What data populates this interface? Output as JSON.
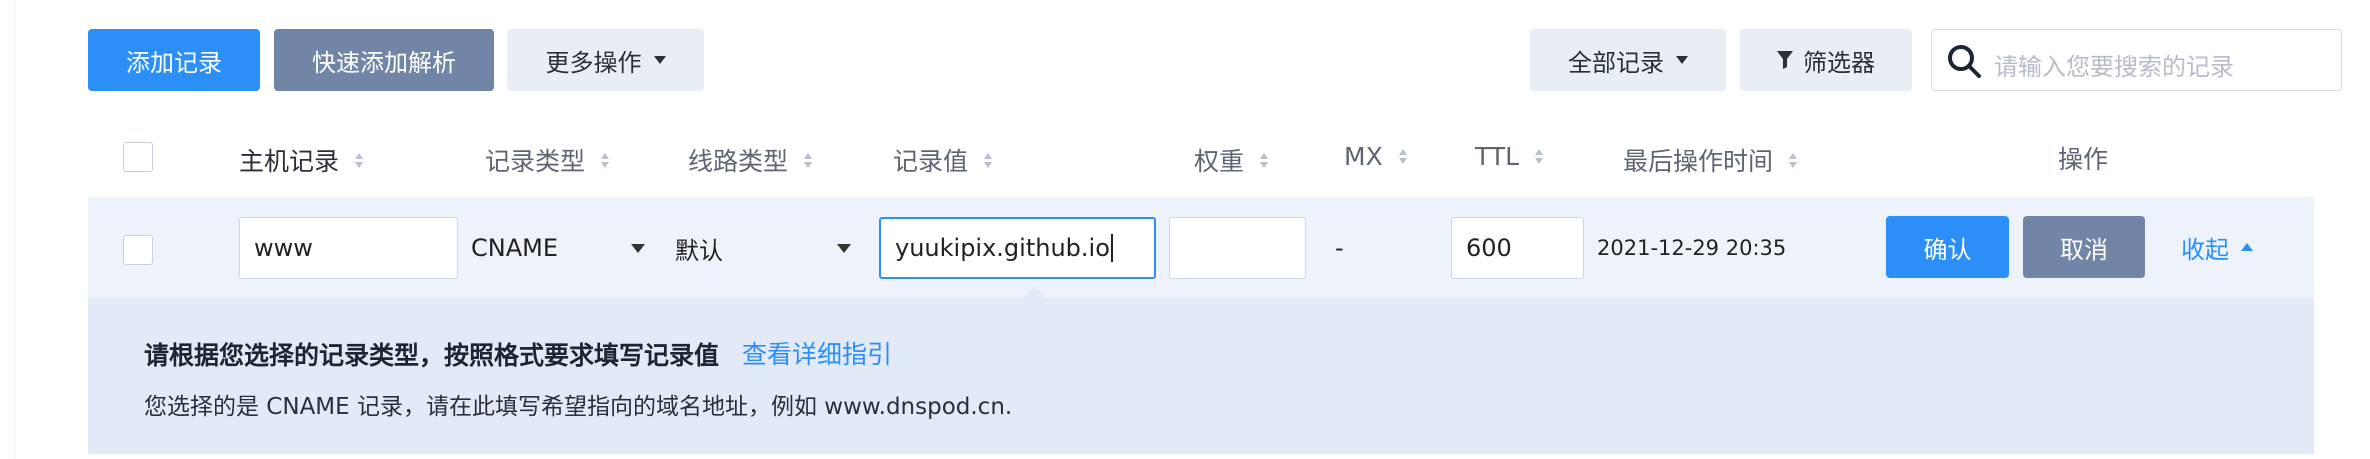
{
  "toolbar": {
    "add_record": "添加记录",
    "quick_add": "快速添加解析",
    "more_actions": "更多操作",
    "all_records": "全部记录",
    "filter": "筛选器",
    "search_placeholder": "请输入您要搜索的记录"
  },
  "table": {
    "headers": {
      "host": "主机记录",
      "type": "记录类型",
      "line": "线路类型",
      "value": "记录值",
      "weight": "权重",
      "mx": "MX",
      "ttl": "TTL",
      "last_modified": "最后操作时间",
      "actions": "操作"
    }
  },
  "edit_row": {
    "host": "www",
    "type": "CNAME",
    "line": "默认",
    "value": "yuukipix.github.io",
    "weight": "",
    "mx": "-",
    "ttl": "600",
    "last_modified": "2021-12-29 20:35",
    "confirm": "确认",
    "cancel": "取消",
    "collapse": "收起"
  },
  "hint": {
    "title": "请根据您选择的记录类型，按照格式要求填写记录值",
    "link": "查看详细指引",
    "body": "您选择的是 CNAME 记录，请在此填写希望指向的域名地址，例如 www.dnspod.cn."
  },
  "colors": {
    "primary": "#2b8ff7",
    "secondary": "#7186a7",
    "link": "#2b8ff7",
    "edit_row_bg": "#eef2fb",
    "hint_bg": "#e2e9f7"
  }
}
